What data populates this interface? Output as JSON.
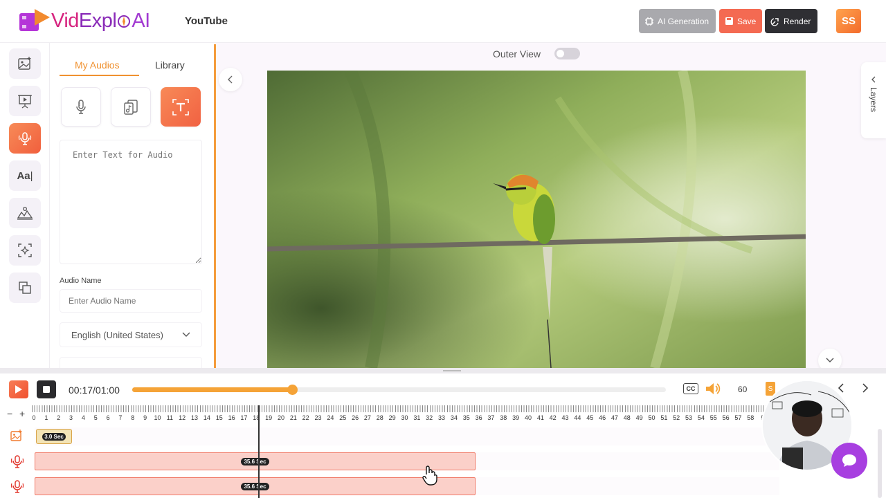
{
  "header": {
    "logo": {
      "part1": "Vid",
      "part2": "Expl",
      "part3": "AI"
    },
    "project_name": "YouTube",
    "ai_generation_label": "AI Generation",
    "save_label": "Save",
    "render_label": "Render",
    "avatar_initials": "SS"
  },
  "rail": {
    "items": [
      {
        "icon": "image-icon"
      },
      {
        "icon": "presentation-icon"
      },
      {
        "icon": "audio-icon",
        "active": true
      },
      {
        "icon": "text-icon",
        "label": "Aa"
      },
      {
        "icon": "elements-icon"
      },
      {
        "icon": "transform-icon"
      },
      {
        "icon": "layers-copy-icon"
      }
    ]
  },
  "audio_panel": {
    "tabs": {
      "my_audios": "My Audios",
      "library": "Library"
    },
    "text_placeholder": "Enter Text for Audio",
    "audio_name_label": "Audio Name",
    "audio_name_placeholder": "Enter Audio Name",
    "language": "English (United States)"
  },
  "canvas": {
    "outer_view_label": "Outer View",
    "outer_view_enabled": false,
    "layers_label": "Layers"
  },
  "player": {
    "time": "00:17/01:00",
    "progress": 0.3,
    "cc_label": "CC",
    "volume": "60",
    "speed_badge": "S"
  },
  "timeline": {
    "zoom_out": "−",
    "zoom_in": "+",
    "ticks": [
      "0",
      "1",
      "2",
      "3",
      "4",
      "5",
      "6",
      "7",
      "8",
      "9",
      "10",
      "11",
      "12",
      "13",
      "14",
      "15",
      "16",
      "17",
      "18",
      "19",
      "20",
      "21",
      "22",
      "23",
      "24",
      "25",
      "26",
      "27",
      "28",
      "29",
      "30",
      "31",
      "32",
      "33",
      "34",
      "35",
      "36",
      "37",
      "38",
      "39",
      "40",
      "41",
      "42",
      "43",
      "44",
      "45",
      "46",
      "47",
      "48",
      "49",
      "50",
      "51",
      "52",
      "53",
      "54",
      "55",
      "56",
      "57",
      "58",
      "5"
    ],
    "image_clip_label": "3.0 Sec",
    "audio_clip_1_label": "35.6 Sec",
    "audio_clip_2_label": "35.6 Sec"
  },
  "colors": {
    "accent_orange": "#f5a337",
    "active_gradient": "#f16142",
    "brand_purple": "#8a2bb8",
    "audio_clip_fill": "#fbd0c9"
  }
}
